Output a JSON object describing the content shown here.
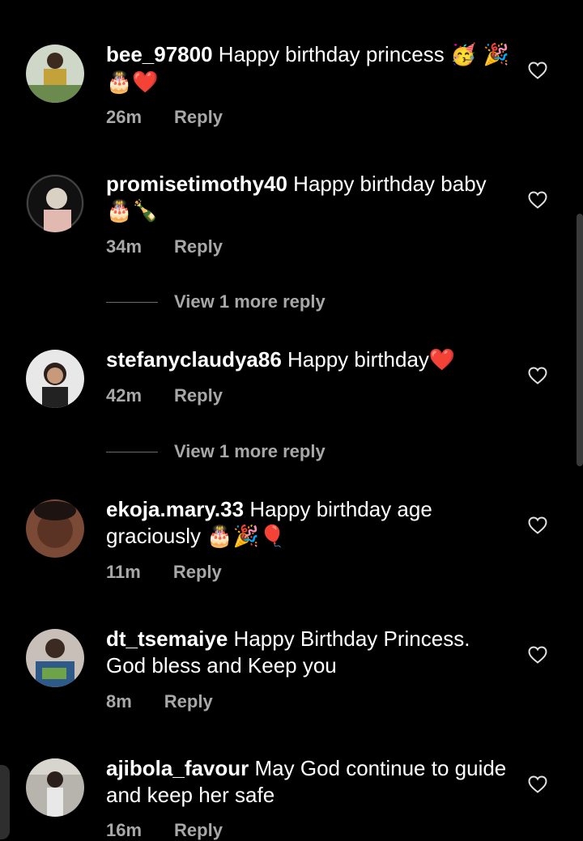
{
  "comments": [
    {
      "username": "bee_97800",
      "text": " Happy birthday princess ",
      "emojis": "🥳 🎉🎂❤️",
      "time": "26m",
      "reply": "Reply"
    },
    {
      "username": "promisetimothy40",
      "text": " Happy birthday baby ",
      "emojis": "🎂🍾",
      "time": "34m",
      "reply": "Reply"
    },
    {
      "username": "stefanyclaudya86",
      "text": " Happy birthday",
      "emojis": "❤️",
      "time": "42m",
      "reply": "Reply"
    },
    {
      "username": "ekoja.mary.33",
      "text": " Happy birthday age graciously ",
      "emojis": "🎂🎉🎈",
      "time": "11m",
      "reply": "Reply"
    },
    {
      "username": "dt_tsemaiye",
      "text": " Happy Birthday Princess. God bless and Keep you",
      "emojis": "",
      "time": "8m",
      "reply": "Reply"
    },
    {
      "username": "ajibola_favour",
      "text": " May God continue to guide and keep her safe",
      "emojis": "",
      "time": "16m",
      "reply": "Reply"
    }
  ],
  "view_more": [
    "View 1 more reply",
    "View 1 more reply"
  ],
  "colors": {
    "background": "#000000",
    "text": "#ffffff",
    "muted": "#a8a8a8"
  }
}
